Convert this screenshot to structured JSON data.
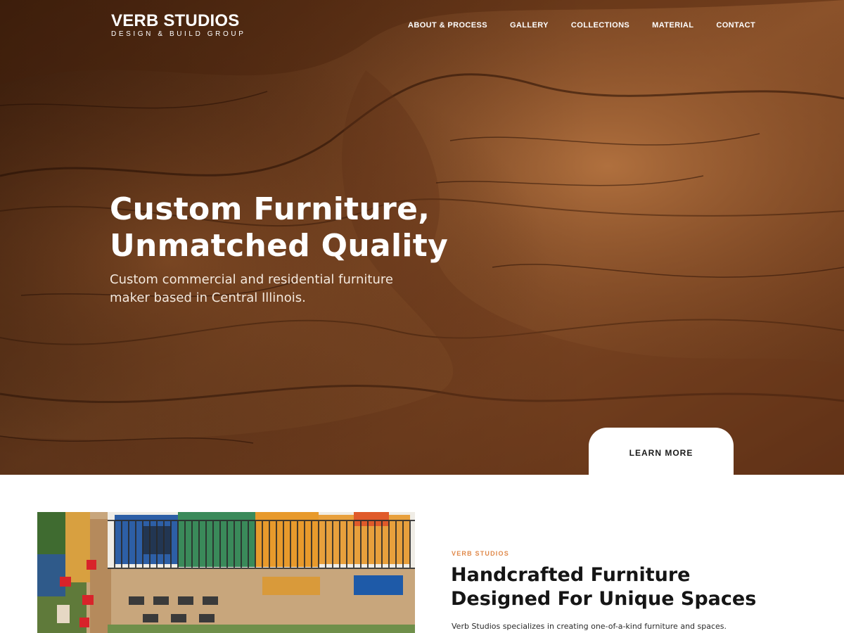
{
  "brand": {
    "name": "VERB STUDIOS",
    "tagline": "DESIGN & BUILD GROUP"
  },
  "nav": {
    "items": [
      "ABOUT & PROCESS",
      "GALLERY",
      "COLLECTIONS",
      "MATERIAL",
      "CONTACT"
    ]
  },
  "hero": {
    "title_line1": "Custom Furniture,",
    "title_line2": "Unmatched Quality",
    "subtitle": "Custom commercial and residential furniture maker based in Central Illinois.",
    "cta_label": "LEARN MORE"
  },
  "intro": {
    "kicker": "VERB STUDIOS",
    "title_line1": "Handcrafted Furniture",
    "title_line2": "Designed For Unique Spaces",
    "body": "Verb Studios specializes in creating one-of-a-kind furniture and spaces."
  },
  "colors": {
    "accent": "#e0894a",
    "hero_wood": "#7a4423",
    "text_dark": "#151515"
  }
}
